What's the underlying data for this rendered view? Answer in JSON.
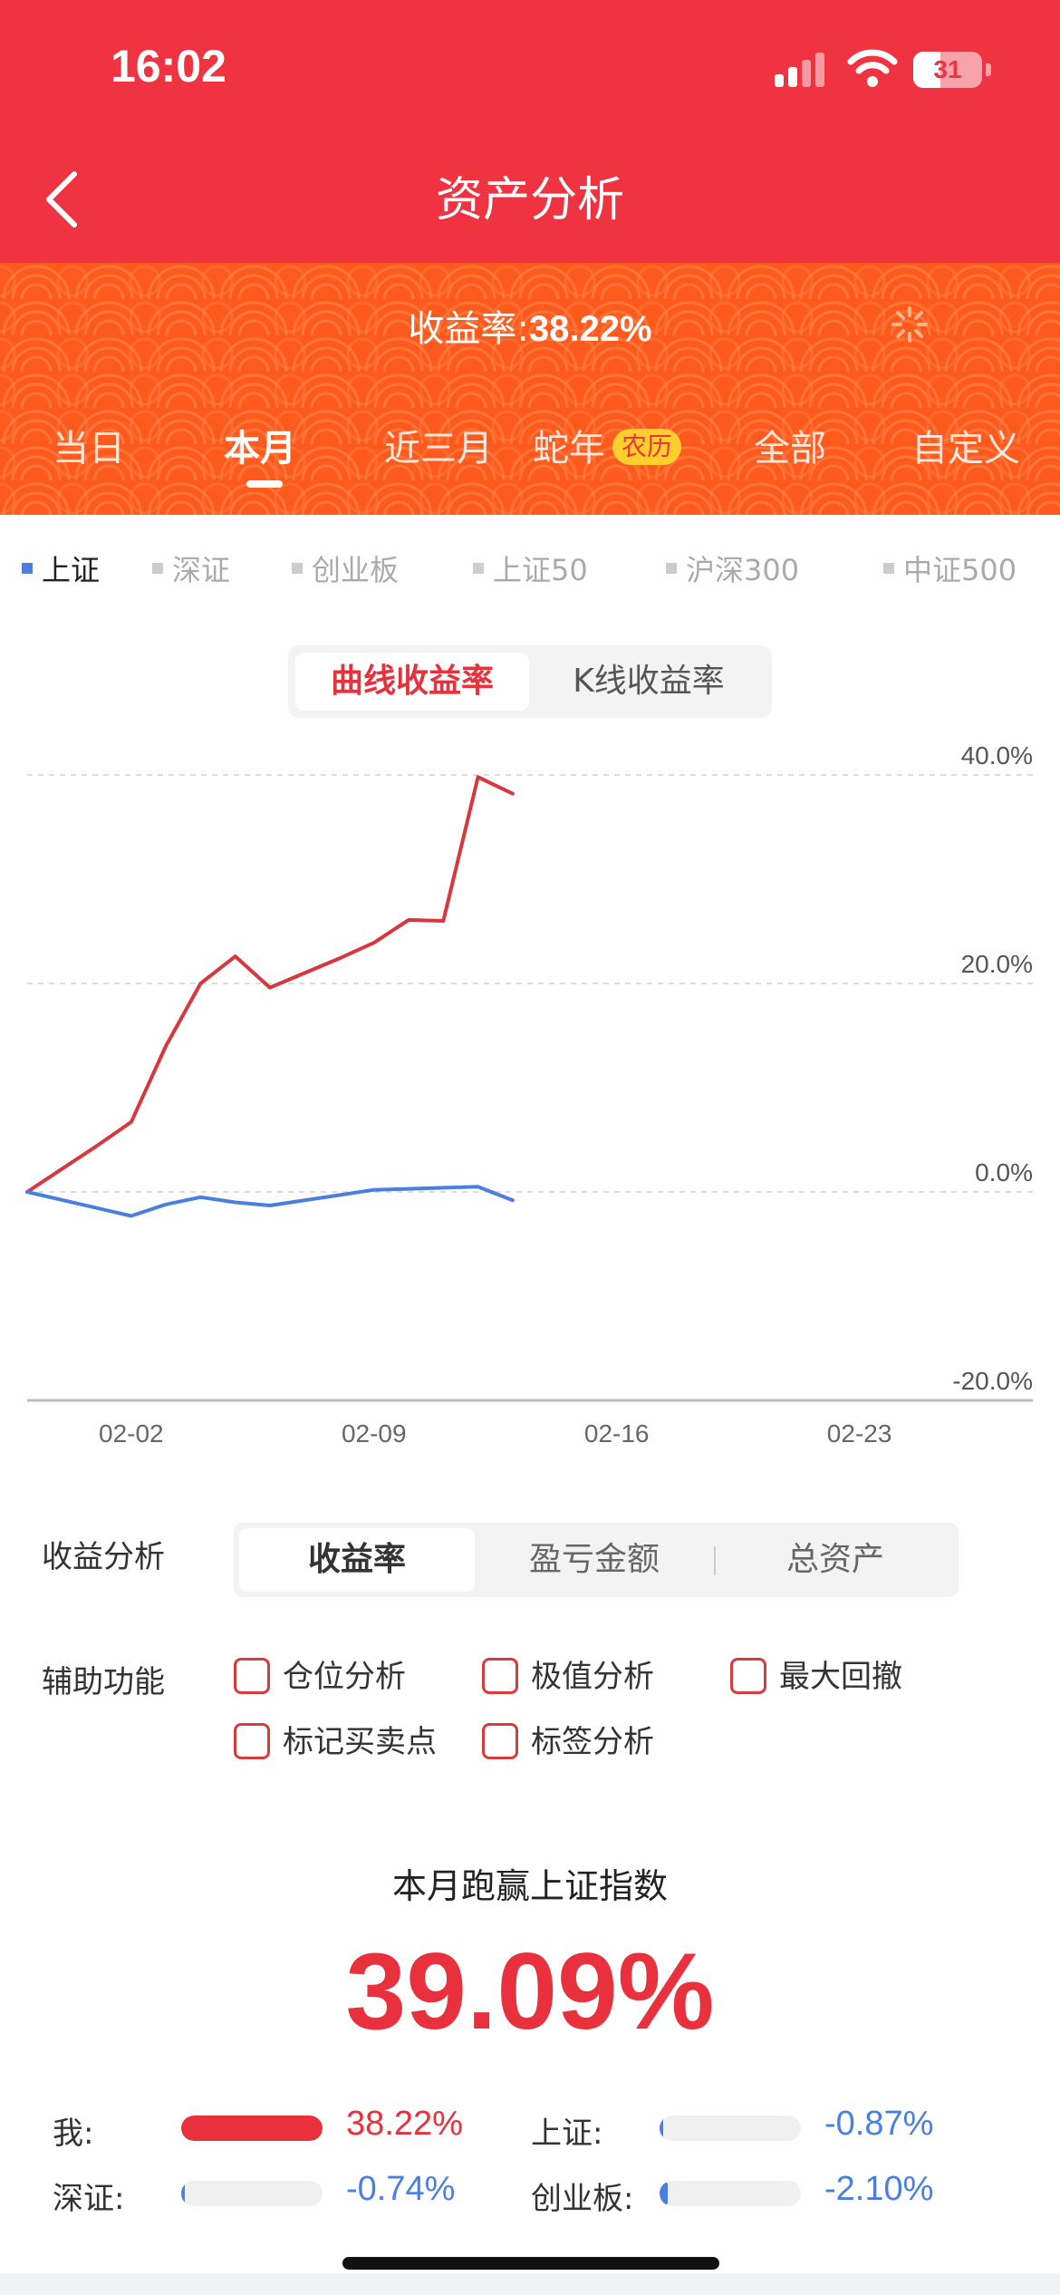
{
  "status": {
    "time": "16:02",
    "battery": "31"
  },
  "nav": {
    "title": "资产分析"
  },
  "banner": {
    "yield_label": "收益率:",
    "yield_value": "38.22%",
    "tabs": [
      {
        "label": "当日"
      },
      {
        "label": "本月"
      },
      {
        "label": "近三月"
      },
      {
        "label": "蛇年",
        "badge": "农历"
      },
      {
        "label": "全部"
      },
      {
        "label": "自定义"
      }
    ],
    "active_tab": "本月"
  },
  "indices": [
    "上证",
    "深证",
    "创业板",
    "上证50",
    "沪深300",
    "中证500"
  ],
  "active_index": "上证",
  "chart_toggle": {
    "curve": "曲线收益率",
    "kline": "K线收益率",
    "active": "曲线收益率"
  },
  "chart_data": {
    "type": "line",
    "y_ticks": [
      "40.0%",
      "20.0%",
      "0.0%",
      "-20.0%"
    ],
    "ylim": [
      -20,
      40
    ],
    "grid": true,
    "x_tick_labels": [
      "02-02",
      "02-09",
      "02-16",
      "02-23"
    ],
    "x_tick_days": [
      2,
      9,
      16,
      23
    ],
    "xlim": [
      -1,
      28
    ],
    "series": [
      {
        "color": "#d9363e",
        "x": [
          -1,
          0,
          1,
          2,
          3,
          4,
          5,
          6,
          7,
          8,
          9,
          10,
          11,
          12,
          13
        ],
        "values": [
          0,
          2.2,
          4.4,
          6.7,
          14,
          20,
          22.6,
          19.6,
          21,
          22.4,
          23.9,
          26.1,
          26,
          39.8,
          38.2
        ]
      },
      {
        "color": "#4a7fe0",
        "x": [
          -1,
          2,
          3,
          4,
          5,
          6,
          9,
          10,
          11,
          12,
          13
        ],
        "values": [
          0,
          -2.3,
          -1.2,
          -0.5,
          -1,
          -1.3,
          0.2,
          0.3,
          0.4,
          0.5,
          -0.8
        ]
      }
    ]
  },
  "analysis": {
    "label": "收益分析",
    "tabs": [
      "收益率",
      "盈亏金额",
      "总资产"
    ],
    "active": "收益率"
  },
  "assist": {
    "label": "辅助功能",
    "options": [
      "仓位分析",
      "极值分析",
      "最大回撤",
      "标记买卖点",
      "标签分析"
    ]
  },
  "beat": {
    "title": "本月跑赢上证指数",
    "value": "39.09%"
  },
  "comparison": [
    {
      "label": "我:",
      "value": "38.22%",
      "color": "#e8313d",
      "fill_fraction": 1.0
    },
    {
      "label": "上证:",
      "value": "-0.87%",
      "color": "#4a7fe0",
      "fill_fraction": 0.023
    },
    {
      "label": "深证:",
      "value": "-0.74%",
      "color": "#4a7fe0",
      "fill_fraction": 0.019
    },
    {
      "label": "创业板:",
      "value": "-2.10%",
      "color": "#4a7fe0",
      "fill_fraction": 0.055
    }
  ]
}
